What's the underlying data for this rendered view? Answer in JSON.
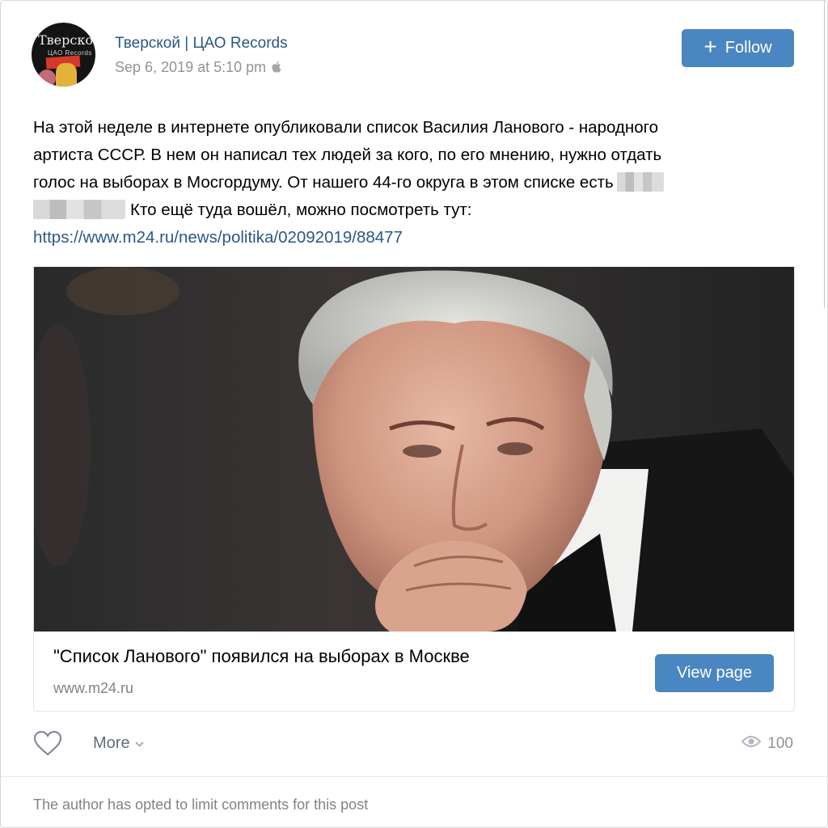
{
  "post": {
    "author": "Тверской | ЦАО Records",
    "date": "Sep 6, 2019 at 5:10 pm",
    "avatar": {
      "line1": "Тверской",
      "line2": "ЦАО Records"
    },
    "follow_label": "Follow",
    "text_lines": [
      "На этой неделе в интернете опубликовали список Василия Ланового - народного",
      "артиста СССР. В нем он написал тех людей за кого, по его мнению, нужно отдать",
      "голос на выборах в Мосгордуму. От нашего 44-го округа в этом списке есть",
      "Кто ещё туда вошёл, можно посмотреть тут:"
    ],
    "link": "https://www.m24.ru/news/politika/02092019/88477"
  },
  "card": {
    "title": "\"Список Ланового\" появился на выборах в Москве",
    "domain": "www.m24.ru",
    "button_label": "View page"
  },
  "actions": {
    "more_label": "More",
    "views_count": "100"
  },
  "footer": {
    "comments_note": "The author has opted to limit comments for this post"
  },
  "colors": {
    "accent": "#4a86c1",
    "link": "#2a5885",
    "muted": "#939393"
  }
}
